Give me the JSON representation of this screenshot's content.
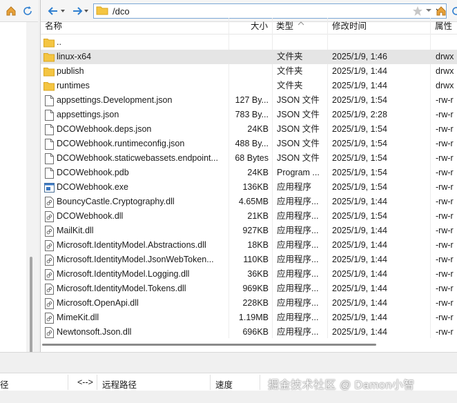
{
  "address": {
    "path": "/dco"
  },
  "columns": {
    "name": "名称",
    "size": "大小",
    "type": "类型",
    "modified": "修改时间",
    "attr": "属性"
  },
  "files": [
    {
      "name": "..",
      "size": "",
      "type": "",
      "modified": "",
      "attr": "",
      "icon": "folder-icon"
    },
    {
      "name": "linux-x64",
      "size": "",
      "type": "文件夹",
      "modified": "2025/1/9, 1:46",
      "attr": "drwx",
      "icon": "folder-icon",
      "selected": true
    },
    {
      "name": "publish",
      "size": "",
      "type": "文件夹",
      "modified": "2025/1/9, 1:44",
      "attr": "drwx",
      "icon": "folder-icon"
    },
    {
      "name": "runtimes",
      "size": "",
      "type": "文件夹",
      "modified": "2025/1/9, 1:44",
      "attr": "drwx",
      "icon": "folder-icon"
    },
    {
      "name": "appsettings.Development.json",
      "size": "127 By...",
      "type": "JSON 文件",
      "modified": "2025/1/9, 1:54",
      "attr": "-rw-r",
      "icon": "file-icon"
    },
    {
      "name": "appsettings.json",
      "size": "783 By...",
      "type": "JSON 文件",
      "modified": "2025/1/9, 2:28",
      "attr": "-rw-r",
      "icon": "file-icon"
    },
    {
      "name": "DCOWebhook.deps.json",
      "size": "24KB",
      "type": "JSON 文件",
      "modified": "2025/1/9, 1:54",
      "attr": "-rw-r",
      "icon": "file-icon"
    },
    {
      "name": "DCOWebhook.runtimeconfig.json",
      "size": "488 By...",
      "type": "JSON 文件",
      "modified": "2025/1/9, 1:54",
      "attr": "-rw-r",
      "icon": "file-icon"
    },
    {
      "name": "DCOWebhook.staticwebassets.endpoint...",
      "size": "68 Bytes",
      "type": "JSON 文件",
      "modified": "2025/1/9, 1:54",
      "attr": "-rw-r",
      "icon": "file-icon"
    },
    {
      "name": "DCOWebhook.pdb",
      "size": "24KB",
      "type": "Program ...",
      "modified": "2025/1/9, 1:54",
      "attr": "-rw-r",
      "icon": "file-icon"
    },
    {
      "name": "DCOWebhook.exe",
      "size": "136KB",
      "type": "应用程序",
      "modified": "2025/1/9, 1:54",
      "attr": "-rw-r",
      "icon": "exe-icon"
    },
    {
      "name": "BouncyCastle.Cryptography.dll",
      "size": "4.65MB",
      "type": "应用程序...",
      "modified": "2025/1/9, 1:44",
      "attr": "-rw-r",
      "icon": "dll-icon"
    },
    {
      "name": "DCOWebhook.dll",
      "size": "21KB",
      "type": "应用程序...",
      "modified": "2025/1/9, 1:54",
      "attr": "-rw-r",
      "icon": "dll-icon"
    },
    {
      "name": "MailKit.dll",
      "size": "927KB",
      "type": "应用程序...",
      "modified": "2025/1/9, 1:44",
      "attr": "-rw-r",
      "icon": "dll-icon"
    },
    {
      "name": "Microsoft.IdentityModel.Abstractions.dll",
      "size": "18KB",
      "type": "应用程序...",
      "modified": "2025/1/9, 1:44",
      "attr": "-rw-r",
      "icon": "dll-icon"
    },
    {
      "name": "Microsoft.IdentityModel.JsonWebToken...",
      "size": "110KB",
      "type": "应用程序...",
      "modified": "2025/1/9, 1:44",
      "attr": "-rw-r",
      "icon": "dll-icon"
    },
    {
      "name": "Microsoft.IdentityModel.Logging.dll",
      "size": "36KB",
      "type": "应用程序...",
      "modified": "2025/1/9, 1:44",
      "attr": "-rw-r",
      "icon": "dll-icon"
    },
    {
      "name": "Microsoft.IdentityModel.Tokens.dll",
      "size": "969KB",
      "type": "应用程序...",
      "modified": "2025/1/9, 1:44",
      "attr": "-rw-r",
      "icon": "dll-icon"
    },
    {
      "name": "Microsoft.OpenApi.dll",
      "size": "228KB",
      "type": "应用程序...",
      "modified": "2025/1/9, 1:44",
      "attr": "-rw-r",
      "icon": "dll-icon"
    },
    {
      "name": "MimeKit.dll",
      "size": "1.19MB",
      "type": "应用程序...",
      "modified": "2025/1/9, 1:44",
      "attr": "-rw-r",
      "icon": "dll-icon"
    },
    {
      "name": "Newtonsoft.Json.dll",
      "size": "696KB",
      "type": "应用程序...",
      "modified": "2025/1/9, 1:44",
      "attr": "-rw-r",
      "icon": "dll-icon"
    }
  ],
  "queue": {
    "local_path": "径",
    "direction": "<-->",
    "remote_path": "远程路径",
    "speed": "速度"
  },
  "watermark": "掘金技术社区 @ Damon小智",
  "colors": {
    "accent_blue": "#2f7fd0",
    "folder_yellow": "#f4c542",
    "selected_row": "#e5e5e5"
  }
}
